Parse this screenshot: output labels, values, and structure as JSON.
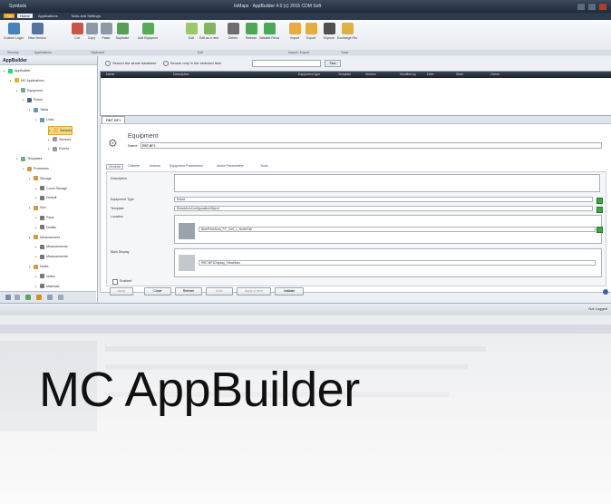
{
  "window": {
    "app_label": "Symbols",
    "title": "InMaps · AppBuilder 4.0 (c) 2015 CDM Soft",
    "min": "_",
    "max": "□",
    "close": "×"
  },
  "menubar": {
    "items": [
      "File",
      "Home",
      "Applications",
      "Tools and Settings"
    ]
  },
  "ribbon": {
    "buttons": [
      {
        "label": "Custom Logins",
        "icon": "user-icon",
        "color": "#2b6cb0"
      },
      {
        "label": "New Version",
        "icon": "shield-icon",
        "color": "#3c5a8c"
      },
      {
        "label": "Cut",
        "icon": "scissors-icon",
        "color": "#c0392b"
      },
      {
        "label": "Copy",
        "icon": "copy-icon",
        "color": "#7a8794"
      },
      {
        "label": "Paste",
        "icon": "paste-icon",
        "color": "#7a8794"
      },
      {
        "label": "Duplicate",
        "icon": "duplicate-icon",
        "color": "#3b8f3b"
      },
      {
        "label": "Add Equipment/Properties",
        "icon": "add-equipment-icon",
        "color": "#3b9d3b"
      },
      {
        "label": "Edit",
        "icon": "check-icon",
        "color": "#8fbf4a"
      },
      {
        "label": "Edit as a new cell",
        "icon": "edit-new-icon",
        "color": "#6fa845"
      },
      {
        "label": "Delete",
        "icon": "delete-icon",
        "color": "#555"
      },
      {
        "label": "Refresh",
        "icon": "refresh-icon",
        "color": "#2e9a3a"
      },
      {
        "label": "Validate Record",
        "icon": "validate-icon",
        "color": "#2e9a3a"
      },
      {
        "label": "Import",
        "icon": "import-icon",
        "color": "#e0a020"
      },
      {
        "label": "Export",
        "icon": "export-icon",
        "color": "#e0a020"
      },
      {
        "label": "Explore",
        "icon": "binoculars-icon",
        "color": "#333"
      },
      {
        "label": "Exchange Records",
        "icon": "lock-icon",
        "color": "#d9a520"
      }
    ],
    "groups": [
      "Security",
      "Applications",
      "Clipboard",
      "Edit",
      "Import / Export",
      "Tools"
    ]
  },
  "leftpanel": {
    "title": "AppBuilder",
    "tree": [
      {
        "label": "AppBuilder",
        "level": 0,
        "color": "#3c7"
      },
      {
        "label": "MC Applications",
        "level": 1,
        "color": "#e6b030"
      },
      {
        "label": "Equipment",
        "level": 2,
        "color": "#7a8"
      },
      {
        "label": "Robot",
        "level": 3,
        "color": "#468"
      },
      {
        "label": "Tasks",
        "level": 4,
        "color": "#69a"
      },
      {
        "label": "Links",
        "level": 5,
        "color": "#69a"
      },
      {
        "label": "Sensors",
        "level": 7,
        "color": "#f1c05a",
        "selected": true
      },
      {
        "label": "Sensors",
        "level": 7,
        "color": "#999"
      },
      {
        "label": "Events",
        "level": 7,
        "color": "#999"
      },
      {
        "label": "Templates",
        "level": 2,
        "color": "#7a8"
      },
      {
        "label": "Processes",
        "level": 3,
        "color": "#c94"
      },
      {
        "label": "Storage",
        "level": 4,
        "color": "#c94"
      },
      {
        "label": "Count Storage",
        "level": 5,
        "color": "#777"
      },
      {
        "label": "Default",
        "level": 5,
        "color": "#777"
      },
      {
        "label": "Sort",
        "level": 4,
        "color": "#c94"
      },
      {
        "label": "Parts",
        "level": 5,
        "color": "#777"
      },
      {
        "label": "Details",
        "level": 5,
        "color": "#777"
      },
      {
        "label": "Measurement",
        "level": 4,
        "color": "#c94"
      },
      {
        "label": "Measurements",
        "level": 5,
        "color": "#777"
      },
      {
        "label": "Measurements",
        "level": 5,
        "color": "#777"
      },
      {
        "label": "Notes",
        "level": 4,
        "color": "#c94"
      },
      {
        "label": "Notes",
        "level": 5,
        "color": "#777"
      },
      {
        "label": "Materials",
        "level": 5,
        "color": "#777"
      }
    ]
  },
  "search": {
    "opt1": "Search the whole database",
    "opt2": "Search only in the selected item",
    "button": "Find"
  },
  "grid": {
    "columns": [
      "Name",
      "Description",
      "Equipment type",
      "Template",
      "Version",
      "Modified by",
      "Date",
      "State",
      "Owner"
    ]
  },
  "tab": {
    "label": "RBT-BF1"
  },
  "detail": {
    "title": "Equipment",
    "name_label": "Name",
    "name_value": "RBT-BF1",
    "subtabs": [
      "General",
      "Children",
      "Actions",
      "Equipment Parameters",
      "Action Parameters",
      "Tools"
    ],
    "fields": {
      "description_label": "Description",
      "equipment_type_label": "Equipment Type",
      "equipment_type_value": "Robot",
      "template_label": "Template",
      "template_value": "RobotArmConfigurationObject",
      "location_label": "Location",
      "location_value": "BluePrintArea_FF_Cell_1_NorthFab",
      "main_display_label": "Main Display",
      "main_display_value": "RBT-BF1Display_ViewMain",
      "enabled_label": "Enabled"
    },
    "buttons": [
      "Apply",
      "Close",
      "Refresh",
      "Undo",
      "Apply & Next",
      "Validate"
    ]
  },
  "status": {
    "text": "Not Logged"
  },
  "caption": "MC AppBuilder"
}
